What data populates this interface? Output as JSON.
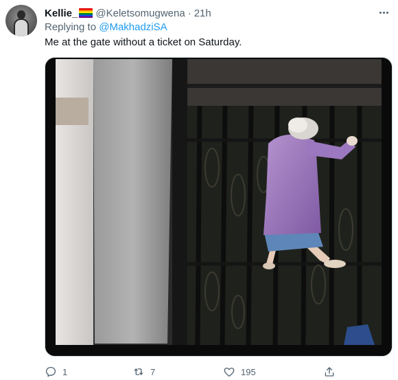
{
  "tweet": {
    "display_name": "Kellie_",
    "handle": "@Keletsomugwena",
    "separator": "·",
    "time": "21h",
    "replying_prefix": "Replying to",
    "replying_to": "@MakhadziSA",
    "text": "Me at the gate without a ticket on Saturday."
  },
  "media": {
    "icon": "photo-image"
  },
  "actions": {
    "reply_count": "1",
    "retweet_count": "7",
    "like_count": "195"
  },
  "colors": {
    "link": "#1d9bf0",
    "secondary_text": "#536471",
    "primary_text": "#0f1419",
    "border": "#cfd9de"
  }
}
